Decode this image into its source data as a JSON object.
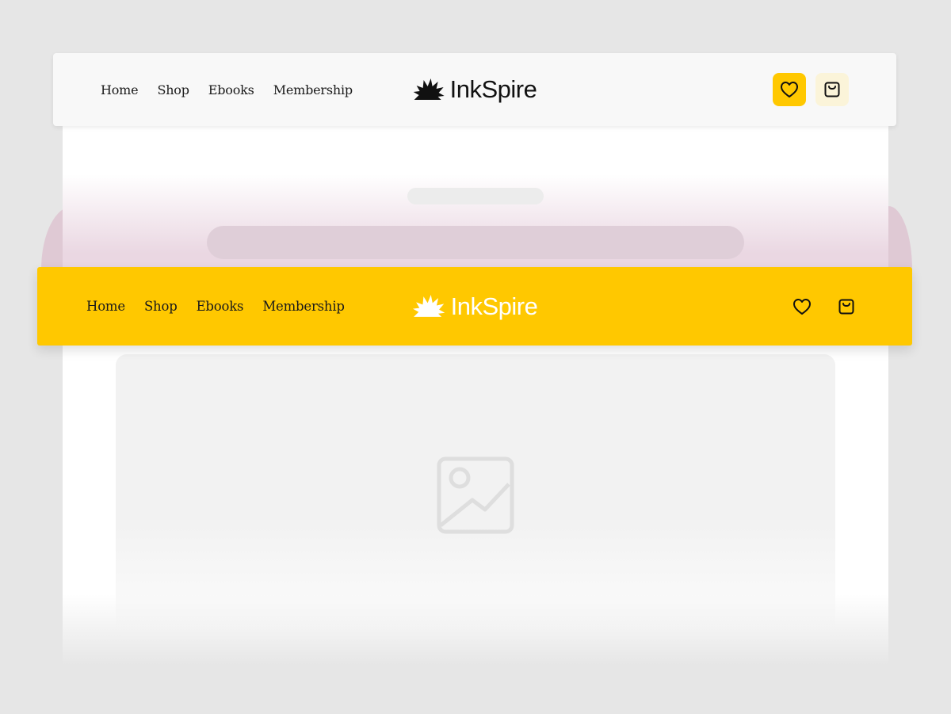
{
  "light_nav": {
    "links": [
      "Home",
      "Shop",
      "Ebooks",
      "Membership"
    ],
    "logo_text": "InkSpire",
    "logo_icon": "ink-splash-icon",
    "wishlist_icon": "heart-icon",
    "cart_icon": "shopping-bag-icon"
  },
  "yellow_nav": {
    "links": [
      "Home",
      "Shop",
      "Ebooks",
      "Membership"
    ],
    "logo_text": "InkSpire",
    "logo_icon": "ink-splash-icon",
    "wishlist_icon": "heart-icon",
    "cart_icon": "shopping-bag-icon"
  },
  "hero": {
    "image_icon": "image-placeholder-icon"
  },
  "colors": {
    "brand_yellow": "#ffc800",
    "light_bg": "#f8f8f8",
    "canvas": "#e6e6e6",
    "hero_tint": "#ead7e2"
  }
}
